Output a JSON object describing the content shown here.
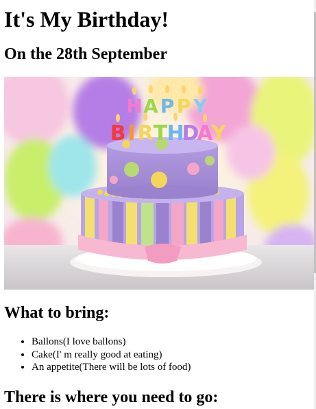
{
  "page": {
    "title": "It's My Birthday!",
    "date_heading": "On the 28th September"
  },
  "hero_image": {
    "icon": "birthday-cake-image",
    "cake_lettering_top": "HAPPY",
    "cake_lettering_bottom": "BIRTHDAY"
  },
  "bring": {
    "heading": "What to bring:",
    "items": [
      "Ballons(I love ballons)",
      "Cake(I' m really good at eating)",
      "An appetite(There will be lots of food)"
    ]
  },
  "directions": {
    "heading": "There is where you need to go:"
  }
}
